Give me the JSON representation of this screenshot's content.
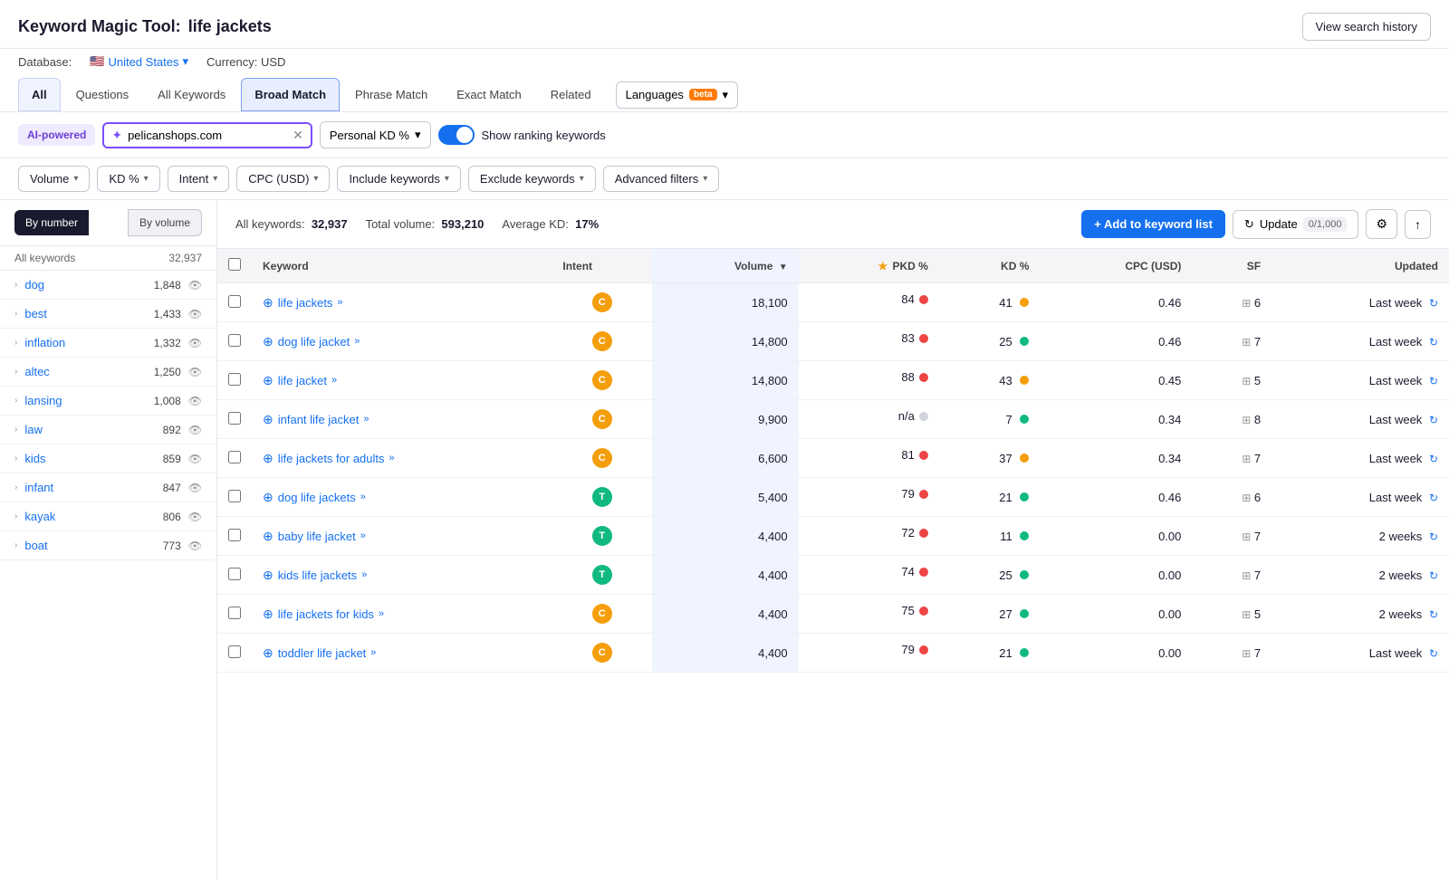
{
  "header": {
    "title": "Keyword Magic Tool:",
    "query": "life jackets",
    "view_history_label": "View search history"
  },
  "db_row": {
    "database_label": "Database:",
    "country": "United States",
    "currency_label": "Currency: USD"
  },
  "tabs": [
    {
      "label": "All",
      "active": true
    },
    {
      "label": "Questions",
      "active": false
    },
    {
      "label": "All Keywords",
      "active": false
    },
    {
      "label": "Broad Match",
      "active": true
    },
    {
      "label": "Phrase Match",
      "active": false
    },
    {
      "label": "Exact Match",
      "active": false
    },
    {
      "label": "Related",
      "active": false
    }
  ],
  "languages_btn": "Languages",
  "filters": {
    "ai_label": "AI-powered",
    "domain_value": "pelicanshops.com",
    "domain_placeholder": "pelicanshops.com",
    "pkd_label": "Personal KD %",
    "toggle_label": "Show ranking keywords"
  },
  "filter_buttons": [
    {
      "label": "Volume",
      "id": "volume-btn"
    },
    {
      "label": "KD %",
      "id": "kd-btn"
    },
    {
      "label": "Intent",
      "id": "intent-btn"
    },
    {
      "label": "CPC (USD)",
      "id": "cpc-btn"
    },
    {
      "label": "Include keywords",
      "id": "include-btn"
    },
    {
      "label": "Exclude keywords",
      "id": "exclude-btn"
    },
    {
      "label": "Advanced filters",
      "id": "advanced-btn"
    }
  ],
  "sidebar": {
    "by_number_label": "By number",
    "by_volume_label": "By volume",
    "all_keywords_label": "All keywords",
    "all_keywords_count": "32,937",
    "items": [
      {
        "text": "dog",
        "count": "1,848"
      },
      {
        "text": "best",
        "count": "1,433"
      },
      {
        "text": "inflation",
        "count": "1,332"
      },
      {
        "text": "altec",
        "count": "1,250"
      },
      {
        "text": "lansing",
        "count": "1,008"
      },
      {
        "text": "law",
        "count": "892"
      },
      {
        "text": "kids",
        "count": "859"
      },
      {
        "text": "infant",
        "count": "847"
      },
      {
        "text": "kayak",
        "count": "806"
      },
      {
        "text": "boat",
        "count": "773"
      }
    ]
  },
  "stats": {
    "all_keywords_label": "All keywords:",
    "all_keywords_count": "32,937",
    "total_volume_label": "Total volume:",
    "total_volume": "593,210",
    "avg_kd_label": "Average KD:",
    "avg_kd": "17%"
  },
  "actions": {
    "add_btn_label": "+ Add to keyword list",
    "update_btn_label": "Update",
    "counter": "0/1,000"
  },
  "table": {
    "columns": [
      "",
      "Keyword",
      "Intent",
      "Volume",
      "PKD %",
      "KD %",
      "CPC (USD)",
      "SF",
      "Updated"
    ],
    "rows": [
      {
        "keyword": "life jackets",
        "intent": "C",
        "intent_type": "c",
        "volume": "18,100",
        "pkd": "84",
        "pkd_dot": "red",
        "kd": "41",
        "kd_dot": "yellow",
        "cpc": "0.46",
        "sf": "6",
        "updated": "Last week"
      },
      {
        "keyword": "dog life jacket",
        "intent": "C",
        "intent_type": "c",
        "volume": "14,800",
        "pkd": "83",
        "pkd_dot": "red",
        "kd": "25",
        "kd_dot": "green",
        "cpc": "0.46",
        "sf": "7",
        "updated": "Last week"
      },
      {
        "keyword": "life jacket",
        "intent": "C",
        "intent_type": "c",
        "volume": "14,800",
        "pkd": "88",
        "pkd_dot": "red",
        "kd": "43",
        "kd_dot": "yellow",
        "cpc": "0.45",
        "sf": "5",
        "updated": "Last week"
      },
      {
        "keyword": "infant life jacket",
        "intent": "C",
        "intent_type": "c",
        "volume": "9,900",
        "pkd": "n/a",
        "pkd_dot": "gray",
        "kd": "7",
        "kd_dot": "green",
        "cpc": "0.34",
        "sf": "8",
        "updated": "Last week"
      },
      {
        "keyword": "life jackets for adults",
        "intent": "C",
        "intent_type": "c",
        "volume": "6,600",
        "pkd": "81",
        "pkd_dot": "red",
        "kd": "37",
        "kd_dot": "yellow",
        "cpc": "0.34",
        "sf": "7",
        "updated": "Last week"
      },
      {
        "keyword": "dog life jackets",
        "intent": "T",
        "intent_type": "t",
        "volume": "5,400",
        "pkd": "79",
        "pkd_dot": "red",
        "kd": "21",
        "kd_dot": "green",
        "cpc": "0.46",
        "sf": "6",
        "updated": "Last week"
      },
      {
        "keyword": "baby life jacket",
        "intent": "T",
        "intent_type": "t",
        "volume": "4,400",
        "pkd": "72",
        "pkd_dot": "red",
        "kd": "11",
        "kd_dot": "green",
        "cpc": "0.00",
        "sf": "7",
        "updated": "2 weeks"
      },
      {
        "keyword": "kids life jackets",
        "intent": "T",
        "intent_type": "t",
        "volume": "4,400",
        "pkd": "74",
        "pkd_dot": "red",
        "kd": "25",
        "kd_dot": "green",
        "cpc": "0.00",
        "sf": "7",
        "updated": "2 weeks"
      },
      {
        "keyword": "life jackets for kids",
        "intent": "C",
        "intent_type": "c",
        "volume": "4,400",
        "pkd": "75",
        "pkd_dot": "red",
        "kd": "27",
        "kd_dot": "green",
        "cpc": "0.00",
        "sf": "5",
        "updated": "2 weeks"
      },
      {
        "keyword": "toddler life jacket",
        "intent": "C",
        "intent_type": "c",
        "volume": "4,400",
        "pkd": "79",
        "pkd_dot": "red",
        "kd": "21",
        "kd_dot": "green",
        "cpc": "0.00",
        "sf": "7",
        "updated": "Last week"
      }
    ]
  }
}
